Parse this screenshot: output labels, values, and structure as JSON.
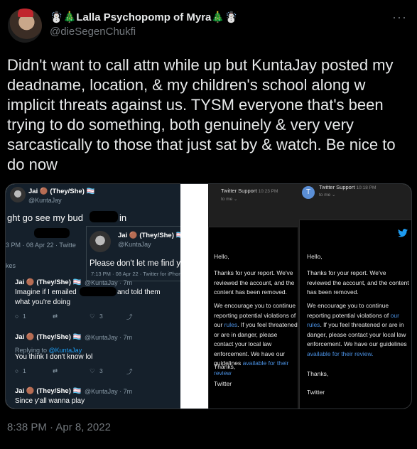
{
  "tweet": {
    "display_name": "☃️🎄Lalla Psychopomp of Myra🎄☃️",
    "handle": "@dieSegenChukfi",
    "text": "Didn't want to call attn while up but KuntaJay posted my deadname, location, & my children's school along w implicit threats against us. TYSM everyone that's been trying to do something, both genuinely & very very sarcastically to those that just sat by & watch. Be nice to do now",
    "timestamp": "8:38 PM · Apr 8, 2022",
    "more_icon": "more-icon"
  },
  "left_screenshot": {
    "top_author": "Jai 🟤 (They/She) 🏳️‍⚧️",
    "top_handle": "@KuntaJay",
    "top_text": "ght go see my bud",
    "top_text_tail": "in",
    "top_meta": "3 PM · 08 Apr 22 · Twitte",
    "likes_fragment": "kes",
    "overlay": {
      "author": "Jai 🟤 (They/She) 🏳️‍⚧️",
      "handle": "@KuntaJay",
      "text": "Please don't let me find you 😂",
      "meta": "7:13 PM · 08 Apr 22 · Twitter for iPhone"
    },
    "replies": [
      {
        "author": "Jai 🟤 (They/She) 🏳️‍⚧️",
        "meta": "@KuntaJay · 7m",
        "line1": "Imagine if I emailed",
        "line1_tail": "and told them",
        "line2": "what you're doing",
        "reply_prefix": "",
        "reply_link": "",
        "reply_count": "1",
        "like_count": "3"
      },
      {
        "author": "Jai 🟤 (They/She) 🏳️‍⚧️",
        "meta": "@KuntaJay · 7m",
        "line1": "You think I don't know lol",
        "line1_tail": "",
        "line2": "",
        "reply_prefix": "Replying to ",
        "reply_link": "@KuntaJay",
        "reply_count": "1",
        "like_count": "3"
      },
      {
        "author": "Jai 🟤 (They/She) 🏳️‍⚧️",
        "meta": "@KuntaJay · 7m",
        "line1": "Since y'all wanna play",
        "line1_tail": "",
        "line2": "",
        "reply_prefix": "",
        "reply_link": "",
        "reply_count": "",
        "like_count": ""
      }
    ]
  },
  "right_screenshot": {
    "email1": {
      "sender": "Twitter Support",
      "time": "10:23 PM",
      "to": "to me ⌄",
      "hello": "Hello,",
      "p1": "Thanks for your report. We've reviewed the account, and the content has been removed.",
      "p2_a": "We encourage you to continue reporting potential violations of our",
      "p2_link": "rules",
      "p2_b": ". If you feel threatened or are in danger, please contact your local law enforcement. We have our guidelines",
      "p2_link2": "available for their review",
      "thanks": "Thanks,",
      "sign": "Twitter"
    },
    "email2": {
      "avatar_letter": "T",
      "sender": "Twitter Support",
      "time": "10:18 PM",
      "to": "to me ⌄",
      "hello": "Hello,",
      "p1": "Thanks for your report. We've reviewed the account, and the content has been removed.",
      "p2_a": "We encourage you to continue reporting potential violations of",
      "p2_link": "our rules",
      "p2_b": ". If you feel threatened or are in danger, please contact your local law enforcement. We have our guidelines",
      "p2_link2": "available for their review.",
      "thanks": "Thanks,",
      "sign": "Twitter"
    }
  },
  "colors": {
    "background": "#000000",
    "text": "#e7e9ea",
    "secondary": "#71767b",
    "link": "#1d9bf0"
  }
}
